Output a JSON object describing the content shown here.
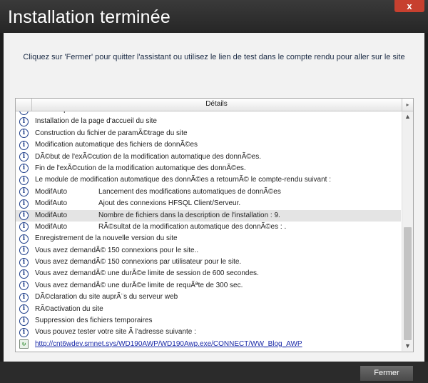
{
  "window": {
    "title": "Installation terminée",
    "close_symbol": "x"
  },
  "instruction": "Cliquez sur 'Fermer' pour quitter l'assistant ou utilisez le lien de test dans le compte rendu pour aller sur le site",
  "list": {
    "header_label": "Détails",
    "header_arrow": "▸",
    "rows": [
      {
        "icon": "info-icon",
        "text": "DÃ©compression terminÃ©e",
        "sub": ""
      },
      {
        "icon": "info-icon",
        "text": "Installation de la page d'accueil du site",
        "sub": ""
      },
      {
        "icon": "info-icon",
        "text": "Construction du fichier de paramÃ©trage du site",
        "sub": ""
      },
      {
        "icon": "info-icon",
        "text": "Modification automatique des fichiers de donnÃ©es",
        "sub": ""
      },
      {
        "icon": "info-icon",
        "text": "DÃ©but de l'exÃ©cution de la modification automatique des donnÃ©es.",
        "sub": ""
      },
      {
        "icon": "info-icon",
        "text": "Fin de l'exÃ©cution de la modification automatique des donnÃ©es.",
        "sub": ""
      },
      {
        "icon": "info-icon",
        "text": "Le module de modification automatique des donnÃ©es a retournÃ© le compte-rendu suivant :",
        "sub": ""
      },
      {
        "icon": "info-icon",
        "text": "ModifAuto",
        "sub": "Lancement des modifications automatiques de donnÃ©es"
      },
      {
        "icon": "info-icon",
        "text": "ModifAuto",
        "sub": "Ajout des connexions HFSQL Client/Serveur."
      },
      {
        "icon": "info-icon",
        "text": "ModifAuto",
        "sub": "Nombre de fichiers dans la description de l'installation : 9.",
        "selected": true
      },
      {
        "icon": "info-icon",
        "text": "ModifAuto",
        "sub": "RÃ©sultat de la modification automatique des donnÃ©es : ."
      },
      {
        "icon": "info-icon",
        "text": "Enregistrement de la nouvelle version du site",
        "sub": ""
      },
      {
        "icon": "info-icon",
        "text": "Vous avez demandÃ© 150 connexions pour le site..",
        "sub": ""
      },
      {
        "icon": "info-icon",
        "text": "Vous avez demandÃ© 150 connexions par utilisateur pour le site.",
        "sub": ""
      },
      {
        "icon": "info-icon",
        "text": "Vous avez demandÃ© une durÃ©e limite de session de 600 secondes.",
        "sub": ""
      },
      {
        "icon": "info-icon",
        "text": "Vous avez demandÃ© une durÃ©e limite de requÃªte de 300 sec.",
        "sub": ""
      },
      {
        "icon": "info-icon",
        "text": "DÃ©claration du site auprÃ¨s du serveur web",
        "sub": ""
      },
      {
        "icon": "info-icon",
        "text": "RÃ©activation du site",
        "sub": ""
      },
      {
        "icon": "info-icon",
        "text": "Suppression des fichiers temporaires",
        "sub": ""
      },
      {
        "icon": "info-icon",
        "text": "Vous pouvez tester votre site Ã  l'adresse suivante :",
        "sub": ""
      },
      {
        "icon": "link-icon",
        "text": "http://cnt6wdev.smnet.sys/WD190AWP/WD190Awp.exe/CONNECT/WW_Blog_AWP",
        "sub": "",
        "link": true
      }
    ]
  },
  "scrollbar": {
    "up": "▲",
    "down": "▼"
  },
  "footer": {
    "fermer_label": "Fermer"
  },
  "colors": {
    "accent_close": "#c7402f",
    "link": "#1a2aa8",
    "info_icon": "#1e3e8a"
  }
}
